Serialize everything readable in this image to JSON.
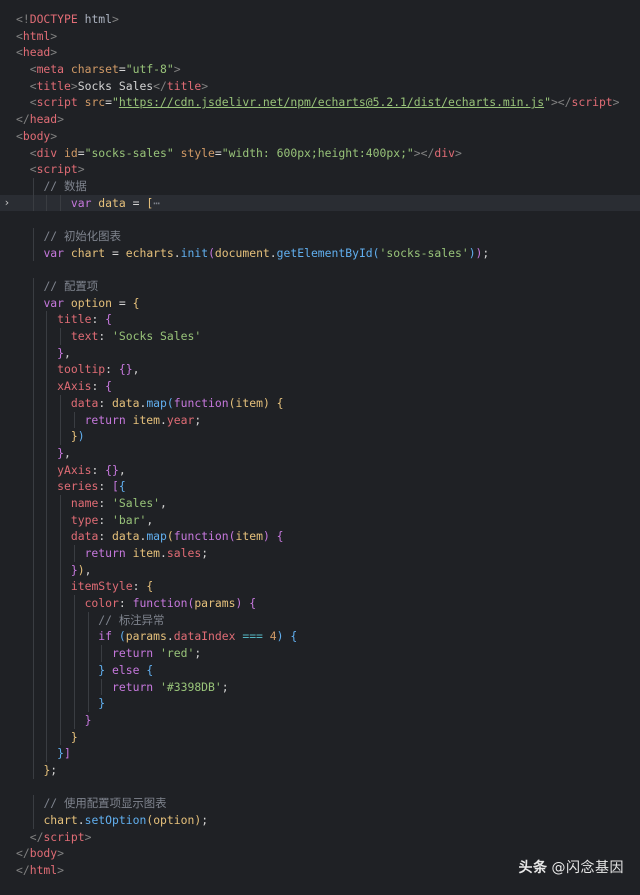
{
  "editor": {
    "theme_colors": {
      "background": "#1f2125",
      "active_line": "#2a2d33",
      "tag": "#e06c75",
      "string": "#98c379",
      "keyword": "#c678dd",
      "function": "#61afef",
      "comment": "#7f848e"
    },
    "lines": [
      {
        "indent": 0,
        "tokens": [
          [
            "t-punct",
            "<!"
          ],
          [
            "t-tag",
            "DOCTYPE"
          ],
          [
            "t-ent",
            " html"
          ],
          [
            "t-punct",
            ">"
          ]
        ]
      },
      {
        "indent": 0,
        "tokens": [
          [
            "t-punct",
            "<"
          ],
          [
            "t-tag",
            "html"
          ],
          [
            "t-punct",
            ">"
          ]
        ]
      },
      {
        "indent": 0,
        "tokens": [
          [
            "t-punct",
            "<"
          ],
          [
            "t-tag",
            "head"
          ],
          [
            "t-punct",
            ">"
          ]
        ]
      },
      {
        "indent": 1,
        "tokens": [
          [
            "t-punct",
            "<"
          ],
          [
            "t-tag",
            "meta"
          ],
          [
            "t-attr",
            " charset"
          ],
          [
            "t-text",
            "="
          ],
          [
            "t-str",
            "\"utf-8\""
          ],
          [
            "t-punct",
            ">"
          ]
        ]
      },
      {
        "indent": 1,
        "tokens": [
          [
            "t-punct",
            "<"
          ],
          [
            "t-tag",
            "title"
          ],
          [
            "t-punct",
            ">"
          ],
          [
            "t-text",
            "Socks Sales"
          ],
          [
            "t-punct",
            "</"
          ],
          [
            "t-tag",
            "title"
          ],
          [
            "t-punct",
            ">"
          ]
        ]
      },
      {
        "indent": 1,
        "tokens": [
          [
            "t-punct",
            "<"
          ],
          [
            "t-tag",
            "script"
          ],
          [
            "t-attr",
            " src"
          ],
          [
            "t-text",
            "="
          ],
          [
            "t-str",
            "\""
          ],
          [
            "t-url",
            "https://cdn.jsdelivr.net/npm/echarts@5.2.1/dist/echarts.min.js"
          ],
          [
            "t-str",
            "\""
          ],
          [
            "t-punct",
            "></"
          ],
          [
            "t-tag",
            "script"
          ],
          [
            "t-punct",
            ">"
          ]
        ]
      },
      {
        "indent": 0,
        "tokens": [
          [
            "t-punct",
            "</"
          ],
          [
            "t-tag",
            "head"
          ],
          [
            "t-punct",
            ">"
          ]
        ]
      },
      {
        "indent": 0,
        "tokens": [
          [
            "t-punct",
            "<"
          ],
          [
            "t-tag",
            "body"
          ],
          [
            "t-punct",
            ">"
          ]
        ]
      },
      {
        "indent": 1,
        "tokens": [
          [
            "t-punct",
            "<"
          ],
          [
            "t-tag",
            "div"
          ],
          [
            "t-attr",
            " id"
          ],
          [
            "t-text",
            "="
          ],
          [
            "t-str",
            "\"socks-sales\""
          ],
          [
            "t-attr",
            " style"
          ],
          [
            "t-text",
            "="
          ],
          [
            "t-str",
            "\"width: 600px;height:400px;\""
          ],
          [
            "t-punct",
            "></"
          ],
          [
            "t-tag",
            "div"
          ],
          [
            "t-punct",
            ">"
          ]
        ]
      },
      {
        "indent": 1,
        "tokens": [
          [
            "t-punct",
            "<"
          ],
          [
            "t-tag",
            "script"
          ],
          [
            "t-punct",
            ">"
          ]
        ]
      },
      {
        "indent": 2,
        "tokens": [
          [
            "t-comment",
            "// 数据"
          ]
        ]
      },
      {
        "indent": 4,
        "active": true,
        "fold": true,
        "tokens": [
          [
            "t-key",
            "var"
          ],
          [
            "t-var",
            " data"
          ],
          [
            "t-text",
            " = "
          ],
          [
            "t-brace",
            "["
          ],
          [
            "t-fold",
            "⋯"
          ]
        ]
      },
      {
        "indent": 0,
        "tokens": []
      },
      {
        "indent": 2,
        "tokens": [
          [
            "t-comment",
            "// 初始化图表"
          ]
        ]
      },
      {
        "indent": 2,
        "tokens": [
          [
            "t-key",
            "var"
          ],
          [
            "t-var",
            " chart"
          ],
          [
            "t-text",
            " = "
          ],
          [
            "t-var",
            "echarts"
          ],
          [
            "t-text",
            "."
          ],
          [
            "t-fn",
            "init"
          ],
          [
            "t-brace2",
            "("
          ],
          [
            "t-var",
            "document"
          ],
          [
            "t-text",
            "."
          ],
          [
            "t-fn",
            "getElementById"
          ],
          [
            "t-brace3",
            "("
          ],
          [
            "t-str",
            "'socks-sales'"
          ],
          [
            "t-brace3",
            ")"
          ],
          [
            "t-brace2",
            ")"
          ],
          [
            "t-text",
            ";"
          ]
        ]
      },
      {
        "indent": 0,
        "tokens": []
      },
      {
        "indent": 2,
        "tokens": [
          [
            "t-comment",
            "// 配置项"
          ]
        ]
      },
      {
        "indent": 2,
        "tokens": [
          [
            "t-key",
            "var"
          ],
          [
            "t-var",
            " option"
          ],
          [
            "t-text",
            " = "
          ],
          [
            "t-brace",
            "{"
          ]
        ]
      },
      {
        "indent": 3,
        "tokens": [
          [
            "t-prop",
            "title"
          ],
          [
            "t-text",
            ": "
          ],
          [
            "t-brace2",
            "{"
          ]
        ]
      },
      {
        "indent": 4,
        "tokens": [
          [
            "t-prop",
            "text"
          ],
          [
            "t-text",
            ": "
          ],
          [
            "t-str",
            "'Socks Sales'"
          ]
        ]
      },
      {
        "indent": 3,
        "tokens": [
          [
            "t-brace2",
            "}"
          ],
          [
            "t-text",
            ","
          ]
        ]
      },
      {
        "indent": 3,
        "tokens": [
          [
            "t-prop",
            "tooltip"
          ],
          [
            "t-text",
            ": "
          ],
          [
            "t-brace2",
            "{}"
          ],
          [
            "t-text",
            ","
          ]
        ]
      },
      {
        "indent": 3,
        "tokens": [
          [
            "t-prop",
            "xAxis"
          ],
          [
            "t-text",
            ": "
          ],
          [
            "t-brace2",
            "{"
          ]
        ]
      },
      {
        "indent": 4,
        "tokens": [
          [
            "t-prop",
            "data"
          ],
          [
            "t-text",
            ": "
          ],
          [
            "t-var",
            "data"
          ],
          [
            "t-text",
            "."
          ],
          [
            "t-fn",
            "map"
          ],
          [
            "t-brace3",
            "("
          ],
          [
            "t-key",
            "function"
          ],
          [
            "t-brace",
            "("
          ],
          [
            "t-var",
            "item"
          ],
          [
            "t-brace",
            ")"
          ],
          [
            "t-text",
            " "
          ],
          [
            "t-brace",
            "{"
          ]
        ]
      },
      {
        "indent": 5,
        "tokens": [
          [
            "t-key",
            "return"
          ],
          [
            "t-var",
            " item"
          ],
          [
            "t-text",
            "."
          ],
          [
            "t-prop",
            "year"
          ],
          [
            "t-text",
            ";"
          ]
        ]
      },
      {
        "indent": 4,
        "tokens": [
          [
            "t-brace",
            "}"
          ],
          [
            "t-brace3",
            ")"
          ]
        ]
      },
      {
        "indent": 3,
        "tokens": [
          [
            "t-brace2",
            "}"
          ],
          [
            "t-text",
            ","
          ]
        ]
      },
      {
        "indent": 3,
        "tokens": [
          [
            "t-prop",
            "yAxis"
          ],
          [
            "t-text",
            ": "
          ],
          [
            "t-brace2",
            "{}"
          ],
          [
            "t-text",
            ","
          ]
        ]
      },
      {
        "indent": 3,
        "tokens": [
          [
            "t-prop",
            "series"
          ],
          [
            "t-text",
            ": "
          ],
          [
            "t-brace2",
            "["
          ],
          [
            "t-brace3",
            "{"
          ]
        ]
      },
      {
        "indent": 4,
        "tokens": [
          [
            "t-prop",
            "name"
          ],
          [
            "t-text",
            ": "
          ],
          [
            "t-str",
            "'Sales'"
          ],
          [
            "t-text",
            ","
          ]
        ]
      },
      {
        "indent": 4,
        "tokens": [
          [
            "t-prop",
            "type"
          ],
          [
            "t-text",
            ": "
          ],
          [
            "t-str",
            "'bar'"
          ],
          [
            "t-text",
            ","
          ]
        ]
      },
      {
        "indent": 4,
        "tokens": [
          [
            "t-prop",
            "data"
          ],
          [
            "t-text",
            ": "
          ],
          [
            "t-var",
            "data"
          ],
          [
            "t-text",
            "."
          ],
          [
            "t-fn",
            "map"
          ],
          [
            "t-brace",
            "("
          ],
          [
            "t-key",
            "function"
          ],
          [
            "t-brace2",
            "("
          ],
          [
            "t-var",
            "item"
          ],
          [
            "t-brace2",
            ")"
          ],
          [
            "t-text",
            " "
          ],
          [
            "t-brace2",
            "{"
          ]
        ]
      },
      {
        "indent": 5,
        "tokens": [
          [
            "t-key",
            "return"
          ],
          [
            "t-var",
            " item"
          ],
          [
            "t-text",
            "."
          ],
          [
            "t-prop",
            "sales"
          ],
          [
            "t-text",
            ";"
          ]
        ]
      },
      {
        "indent": 4,
        "tokens": [
          [
            "t-brace2",
            "}"
          ],
          [
            "t-brace",
            ")"
          ],
          [
            "t-text",
            ","
          ]
        ]
      },
      {
        "indent": 4,
        "tokens": [
          [
            "t-prop",
            "itemStyle"
          ],
          [
            "t-text",
            ": "
          ],
          [
            "t-brace",
            "{"
          ]
        ]
      },
      {
        "indent": 5,
        "tokens": [
          [
            "t-prop",
            "color"
          ],
          [
            "t-text",
            ": "
          ],
          [
            "t-key",
            "function"
          ],
          [
            "t-brace2",
            "("
          ],
          [
            "t-var",
            "params"
          ],
          [
            "t-brace2",
            ")"
          ],
          [
            "t-text",
            " "
          ],
          [
            "t-brace2",
            "{"
          ]
        ]
      },
      {
        "indent": 6,
        "tokens": [
          [
            "t-comment",
            "// 标注异常"
          ]
        ]
      },
      {
        "indent": 6,
        "tokens": [
          [
            "t-key",
            "if"
          ],
          [
            "t-text",
            " "
          ],
          [
            "t-brace3",
            "("
          ],
          [
            "t-var",
            "params"
          ],
          [
            "t-text",
            "."
          ],
          [
            "t-prop",
            "dataIndex"
          ],
          [
            "t-text",
            " "
          ],
          [
            "t-op",
            "==="
          ],
          [
            "t-text",
            " "
          ],
          [
            "t-num",
            "4"
          ],
          [
            "t-brace3",
            ")"
          ],
          [
            "t-text",
            " "
          ],
          [
            "t-brace3",
            "{"
          ]
        ]
      },
      {
        "indent": 7,
        "tokens": [
          [
            "t-key",
            "return"
          ],
          [
            "t-text",
            " "
          ],
          [
            "t-str",
            "'red'"
          ],
          [
            "t-text",
            ";"
          ]
        ]
      },
      {
        "indent": 6,
        "tokens": [
          [
            "t-brace3",
            "}"
          ],
          [
            "t-text",
            " "
          ],
          [
            "t-key",
            "else"
          ],
          [
            "t-text",
            " "
          ],
          [
            "t-brace3",
            "{"
          ]
        ]
      },
      {
        "indent": 7,
        "tokens": [
          [
            "t-key",
            "return"
          ],
          [
            "t-text",
            " "
          ],
          [
            "t-str",
            "'#3398DB'"
          ],
          [
            "t-text",
            ";"
          ]
        ]
      },
      {
        "indent": 6,
        "tokens": [
          [
            "t-brace3",
            "}"
          ]
        ]
      },
      {
        "indent": 5,
        "tokens": [
          [
            "t-brace2",
            "}"
          ]
        ]
      },
      {
        "indent": 4,
        "tokens": [
          [
            "t-brace",
            "}"
          ]
        ]
      },
      {
        "indent": 3,
        "tokens": [
          [
            "t-brace3",
            "}"
          ],
          [
            "t-brace2",
            "]"
          ]
        ]
      },
      {
        "indent": 2,
        "tokens": [
          [
            "t-brace",
            "}"
          ],
          [
            "t-text",
            ";"
          ]
        ]
      },
      {
        "indent": 0,
        "tokens": []
      },
      {
        "indent": 2,
        "tokens": [
          [
            "t-comment",
            "// 使用配置项显示图表"
          ]
        ]
      },
      {
        "indent": 2,
        "tokens": [
          [
            "t-var",
            "chart"
          ],
          [
            "t-text",
            "."
          ],
          [
            "t-fn",
            "setOption"
          ],
          [
            "t-brace",
            "("
          ],
          [
            "t-var",
            "option"
          ],
          [
            "t-brace",
            ")"
          ],
          [
            "t-text",
            ";"
          ]
        ]
      },
      {
        "indent": 1,
        "tokens": [
          [
            "t-punct",
            "</"
          ],
          [
            "t-tag",
            "script"
          ],
          [
            "t-punct",
            ">"
          ]
        ]
      },
      {
        "indent": 0,
        "tokens": [
          [
            "t-punct",
            "</"
          ],
          [
            "t-tag",
            "body"
          ],
          [
            "t-punct",
            ">"
          ]
        ]
      },
      {
        "indent": 0,
        "tokens": [
          [
            "t-punct",
            "</"
          ],
          [
            "t-tag",
            "html"
          ],
          [
            "t-punct",
            ">"
          ]
        ]
      }
    ],
    "fold_icon": "chevron-right-icon"
  },
  "watermark": {
    "brand": "头条",
    "author": "@闪念基因"
  }
}
